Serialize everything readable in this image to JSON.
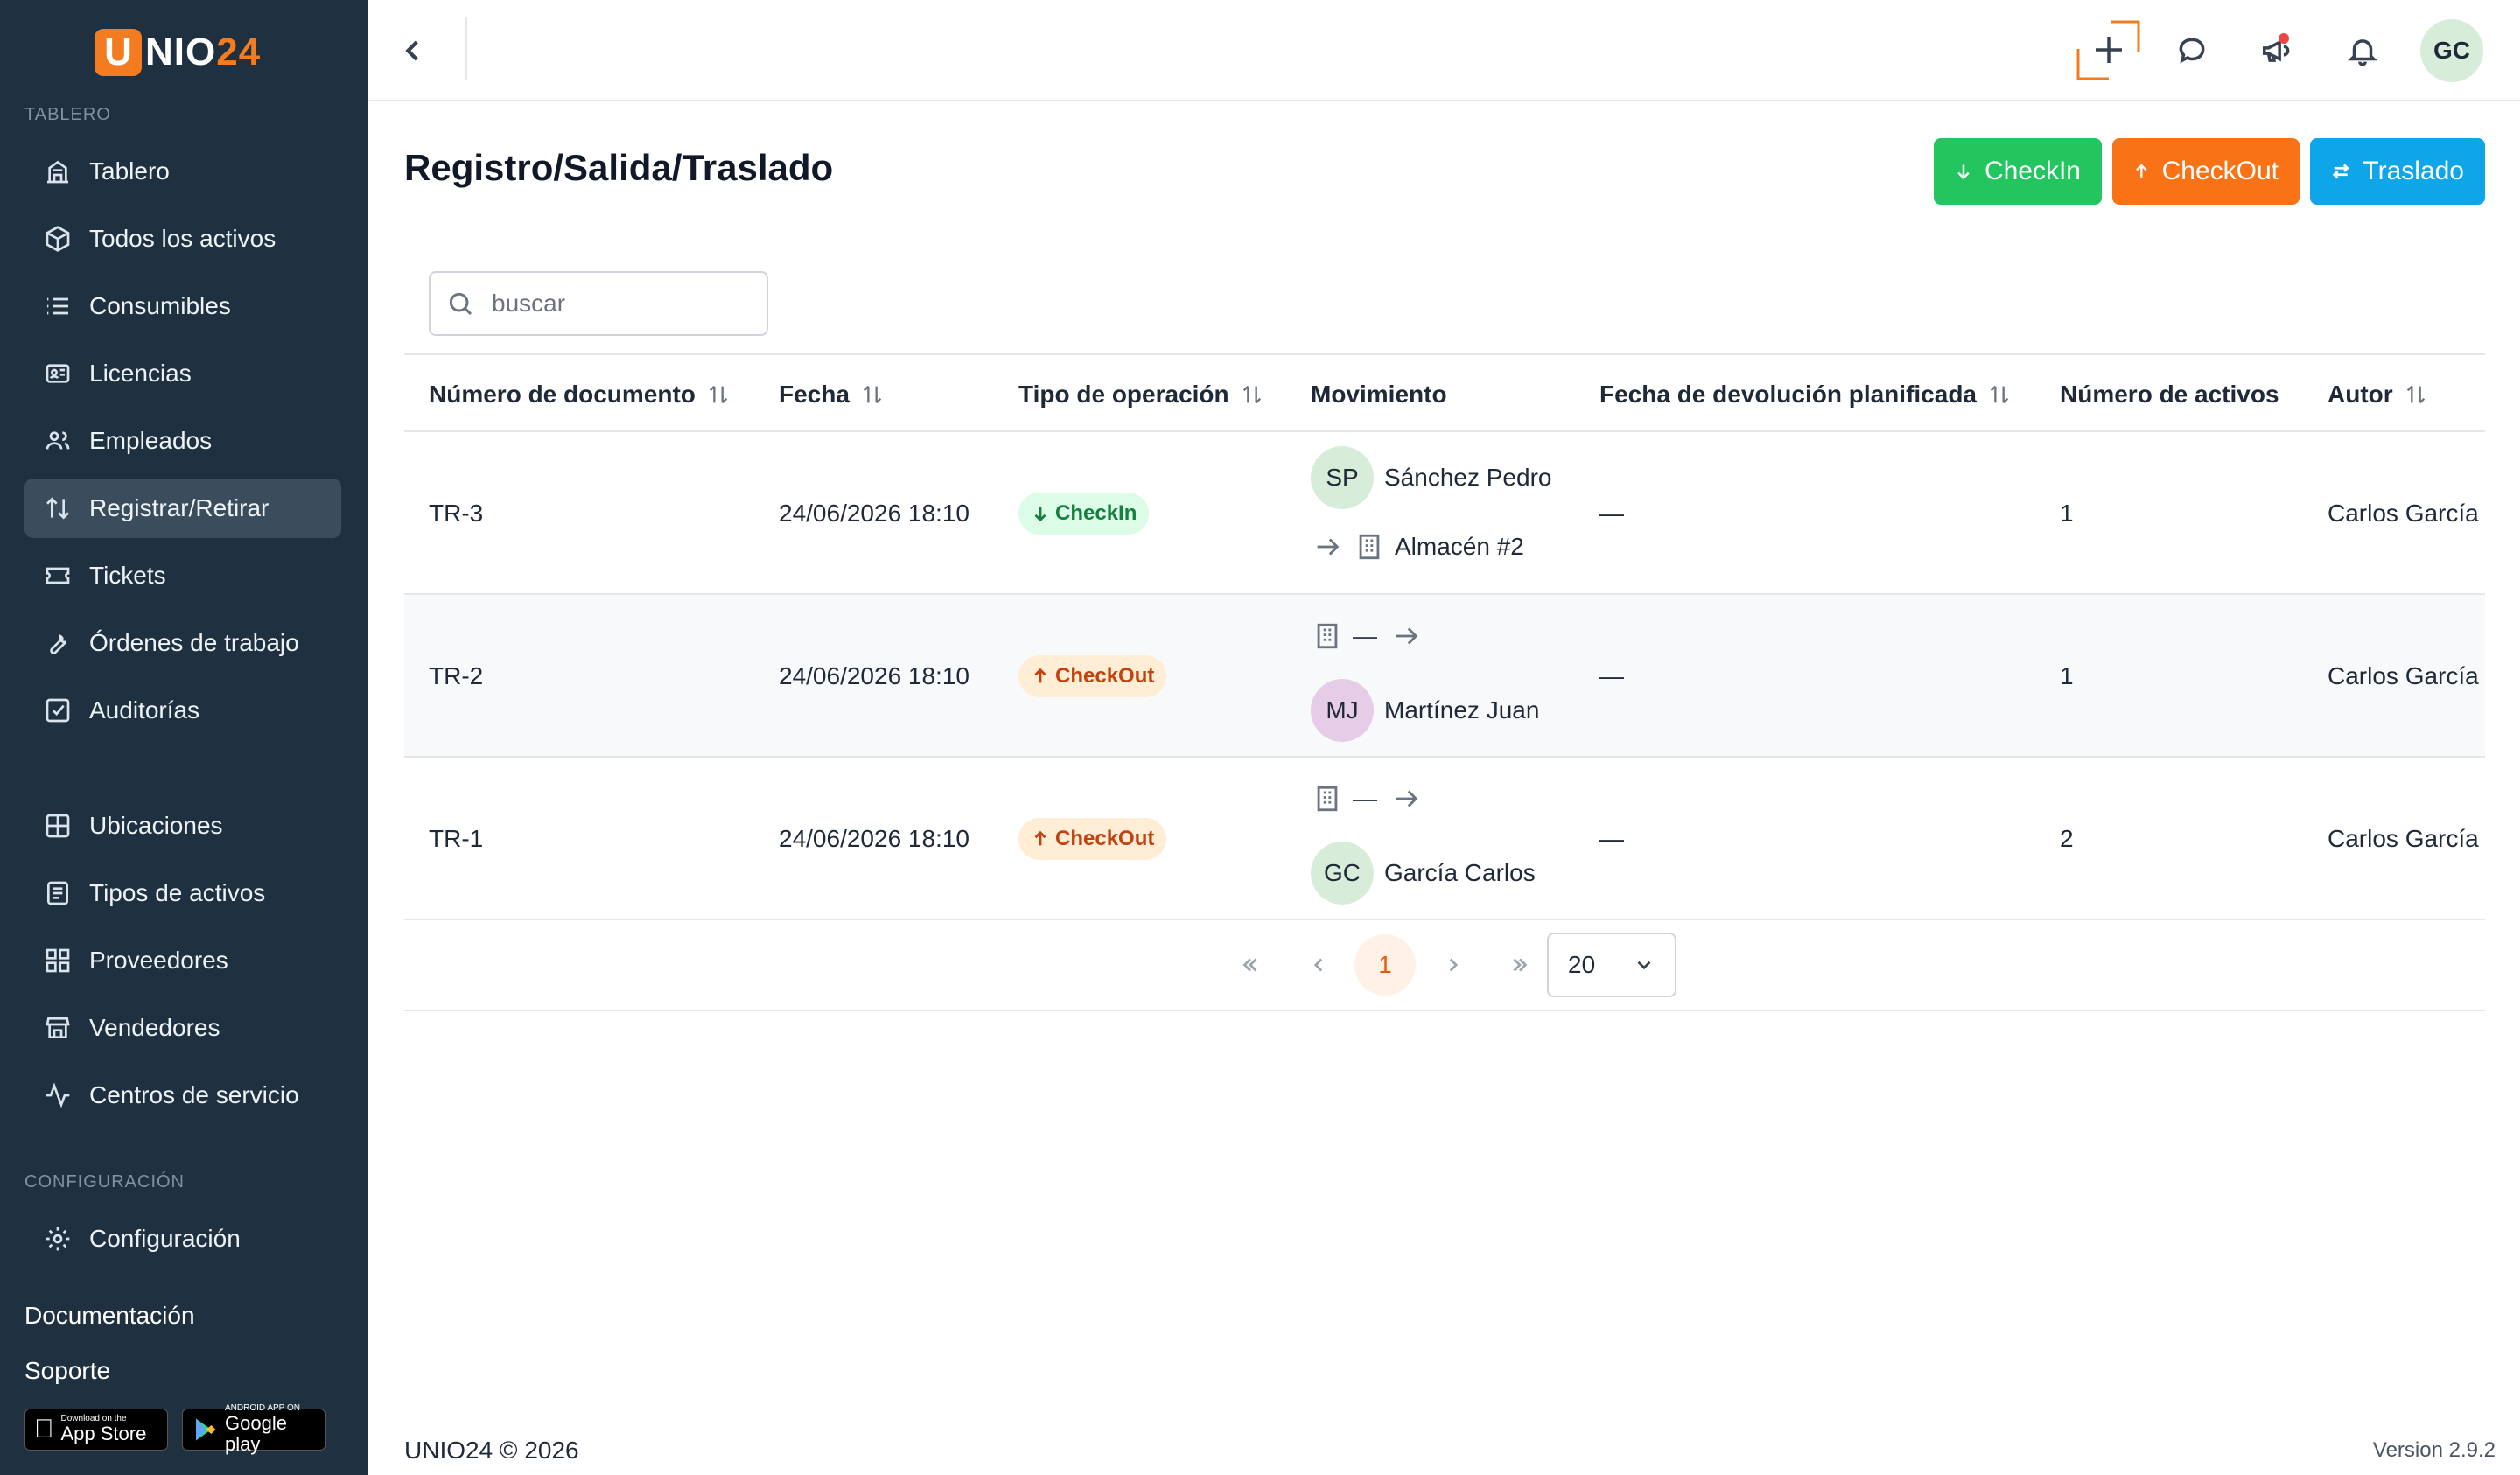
{
  "app": {
    "logo_letter": "U",
    "logo_mid": "NIO",
    "logo_end": "24",
    "brand_color": "#f47c20"
  },
  "sidebar": {
    "section1": "TABLERO",
    "items1": [
      {
        "label": "Tablero",
        "icon": "dashboard-icon"
      },
      {
        "label": "Todos los activos",
        "icon": "cube-icon"
      },
      {
        "label": "Consumibles",
        "icon": "list-icon"
      },
      {
        "label": "Licencias",
        "icon": "license-icon"
      },
      {
        "label": "Empleados",
        "icon": "users-icon"
      },
      {
        "label": "Registrar/Retirar",
        "icon": "swap-vertical-icon",
        "active": true
      },
      {
        "label": "Tickets",
        "icon": "ticket-icon"
      },
      {
        "label": "Órdenes de trabajo",
        "icon": "wrench-icon"
      },
      {
        "label": "Auditorías",
        "icon": "checkbox-icon"
      }
    ],
    "items2": [
      {
        "label": "Ubicaciones",
        "icon": "grid-icon"
      },
      {
        "label": "Tipos de activos",
        "icon": "document-icon"
      },
      {
        "label": "Proveedores",
        "icon": "apps-icon"
      },
      {
        "label": "Vendedores",
        "icon": "store-icon"
      },
      {
        "label": "Centros de servicio",
        "icon": "activity-icon"
      }
    ],
    "section2": "CONFIGURACIÓN",
    "config": {
      "label": "Configuración",
      "icon": "gear-icon"
    },
    "documentation": "Documentación",
    "support": "Soporte",
    "appstore_small": "Download on the",
    "appstore_big": "App Store",
    "googleplay_small": "ANDROID APP ON",
    "googleplay_big": "Google play"
  },
  "topbar": {
    "avatar_initials": "GC"
  },
  "page": {
    "title": "Registro/Salida/Traslado",
    "btn_checkin": "CheckIn",
    "btn_checkout": "CheckOut",
    "btn_traslado": "Traslado",
    "search_placeholder": "buscar"
  },
  "table": {
    "headers": {
      "doc": "Número de documento",
      "fecha": "Fecha",
      "tipo": "Tipo de operación",
      "mov": "Movimiento",
      "devol": "Fecha de devolución planificada",
      "num": "Número de activos",
      "autor": "Autor"
    },
    "rows": [
      {
        "doc": "TR-3",
        "fecha": "24/06/2026 18:10",
        "tipo": "CheckIn",
        "from_initials": "SP",
        "from_name": "Sánchez Pedro",
        "to_name": "Almacén #2",
        "devol": "—",
        "num": "1",
        "autor": "Carlos García"
      },
      {
        "doc": "TR-2",
        "fecha": "24/06/2026 18:10",
        "tipo": "CheckOut",
        "from_dash": "—",
        "to_initials": "MJ",
        "to_name": "Martínez Juan",
        "devol": "—",
        "num": "1",
        "autor": "Carlos García"
      },
      {
        "doc": "TR-1",
        "fecha": "24/06/2026 18:10",
        "tipo": "CheckOut",
        "from_dash": "—",
        "to_initials": "GC",
        "to_name": "García Carlos",
        "devol": "—",
        "num": "2",
        "autor": "Carlos García"
      }
    ]
  },
  "pagination": {
    "current": "1",
    "page_size": "20"
  },
  "footer": {
    "copyright": "UNIO24 © 2026",
    "version": "Version 2.9.2"
  },
  "colors": {
    "checkin": "#22c55e",
    "checkout": "#f97316",
    "traslado": "#0ea5e9",
    "sidebar": "#1f3140"
  }
}
